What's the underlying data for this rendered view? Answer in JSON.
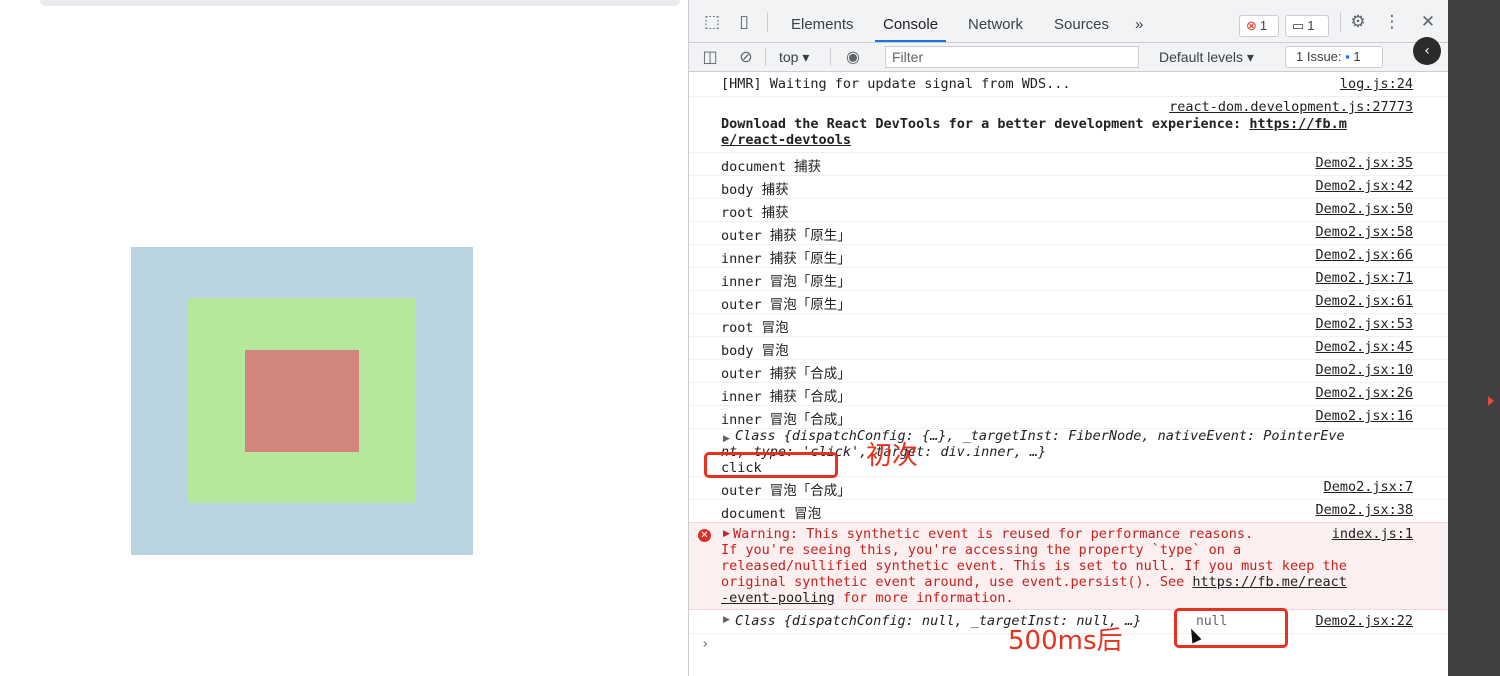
{
  "page": {
    "colors": {
      "outer": "#bad5df",
      "middle": "#b5e89c",
      "inner": "#d1857c"
    }
  },
  "devtools": {
    "tabs": [
      "Elements",
      "Console",
      "Network",
      "Sources"
    ],
    "active_tab": "Console",
    "more_tabs": "»",
    "errors_badge": "1",
    "messages_badge": "1",
    "toolbar": {
      "context": "top ▾",
      "filter_placeholder": "Filter",
      "levels": "Default levels ▾",
      "issues": "1 Issue:",
      "issues_count": "1"
    },
    "logs": [
      {
        "text": "[HMR] Waiting for update signal from WDS...",
        "src": "log.js:24"
      },
      {
        "src": "react-dom.development.js:27773",
        "text_bold": "Download the React DevTools for a better development experience: ",
        "link1": "https://fb.m",
        "link2": "e/react-devtools"
      },
      {
        "text": "document 捕获",
        "src": "Demo2.jsx:35"
      },
      {
        "text": "body 捕获",
        "src": "Demo2.jsx:42"
      },
      {
        "text": "root 捕获",
        "src": "Demo2.jsx:50"
      },
      {
        "text": "outer 捕获「原生」",
        "src": "Demo2.jsx:58"
      },
      {
        "text": "inner 捕获「原生」",
        "src": "Demo2.jsx:66"
      },
      {
        "text": "inner 冒泡「原生」",
        "src": "Demo2.jsx:71"
      },
      {
        "text": "outer 冒泡「原生」",
        "src": "Demo2.jsx:61"
      },
      {
        "text": "root 冒泡",
        "src": "Demo2.jsx:53"
      },
      {
        "text": "body 冒泡",
        "src": "Demo2.jsx:45"
      },
      {
        "text": "outer 捕获「合成」",
        "src": "Demo2.jsx:10"
      },
      {
        "text": "inner 捕获「合成」",
        "src": "Demo2.jsx:26"
      },
      {
        "text": "inner 冒泡「合成」",
        "src": "Demo2.jsx:16"
      },
      {
        "obj_line1": "Class {dispatchConfig: {…}, _targetInst: FiberNode, nativeEvent: PointerEve",
        "obj_line2": "nt, type: 'click', target: div.inner, …}",
        "click": "click"
      },
      {
        "text": "outer 冒泡「合成」",
        "src": "Demo2.jsx:7"
      },
      {
        "text": "document 冒泡",
        "src": "Demo2.jsx:38"
      },
      {
        "warn_line1": "Warning: This synthetic event is reused for performance reasons.",
        "warn_src": "index.js:1",
        "warn_line2": "If you're seeing this, you're accessing the property `type` on a",
        "warn_line3": "released/nullified synthetic event. This is set to null. If you must keep the",
        "warn_line4": "original synthetic event around, use event.persist(). See ",
        "warn_link1": "https://fb.me/react",
        "warn_link2": "-event-pooling",
        "warn_tail": " for more information."
      },
      {
        "obj": "Class {dispatchConfig: null, _targetInst: null, …}",
        "null": "null",
        "src": "Demo2.jsx:22"
      }
    ],
    "prompt": "›"
  },
  "annotations": {
    "first": "初次",
    "after": "500ms后"
  }
}
